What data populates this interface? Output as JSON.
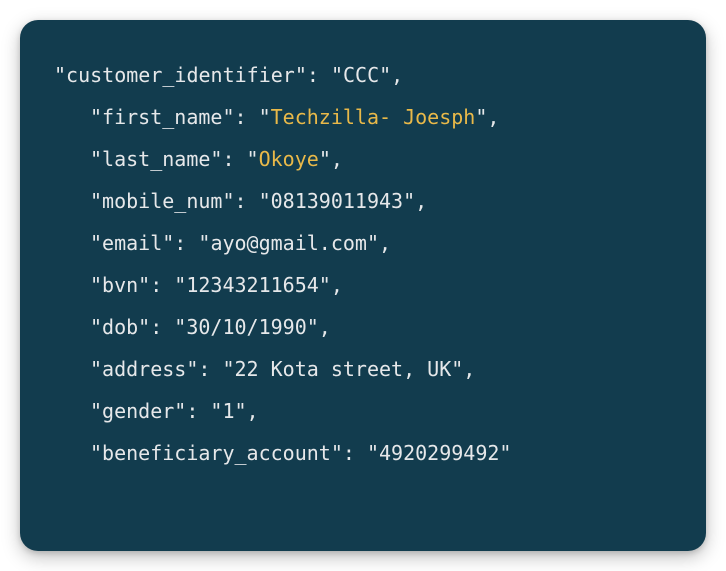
{
  "code": {
    "lines": [
      {
        "indent": 0,
        "key": "customer_identifier",
        "value": "CCC",
        "highlight": false
      },
      {
        "indent": 1,
        "key": "first_name",
        "value": "Techzilla- Joesph",
        "highlight": true
      },
      {
        "indent": 1,
        "key": "last_name",
        "value": "Okoye",
        "highlight": true
      },
      {
        "indent": 1,
        "key": "mobile_num",
        "value": "08139011943",
        "highlight": false
      },
      {
        "indent": 1,
        "key": "email",
        "value": "ayo@gmail.com",
        "highlight": false
      },
      {
        "indent": 1,
        "key": "bvn",
        "value": "12343211654",
        "highlight": false
      },
      {
        "indent": 1,
        "key": "dob",
        "value": "30/10/1990",
        "highlight": false
      },
      {
        "indent": 1,
        "key": "address",
        "value": "22 Kota street, UK",
        "highlight": false
      },
      {
        "indent": 1,
        "key": "gender",
        "value": "1",
        "highlight": false
      },
      {
        "indent": 1,
        "key": "beneficiary_account",
        "value": "4920299492",
        "highlight": false,
        "last": true
      }
    ]
  }
}
